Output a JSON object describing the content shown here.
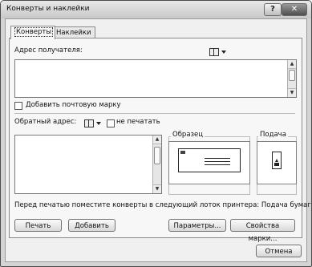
{
  "window": {
    "title": "Конверты и наклейки",
    "help_label": "?",
    "close_label": "✕"
  },
  "tabs": [
    {
      "label": "Конверты",
      "active": true
    },
    {
      "label": "Наклейки",
      "active": false
    }
  ],
  "recipient": {
    "label": "Адрес получателя:",
    "value": ""
  },
  "add_postage": {
    "label": "Добавить почтовую марку",
    "checked": false
  },
  "return_address": {
    "label": "Обратный адрес:",
    "value": "",
    "omit_label": "не печатать",
    "omit_checked": false
  },
  "preview": {
    "title": "Образец"
  },
  "feed": {
    "title": "Подача"
  },
  "notice": "Перед печатью поместите конверты в следующий лоток принтера: Подача бумаги.",
  "buttons": {
    "print": "Печать",
    "add": "Добавить",
    "options": "Параметры...",
    "postage_props": "Свойства марки...",
    "cancel": "Отмена"
  },
  "icons": {
    "address_book": "address-book-icon",
    "dropdown": "chevron-down-icon"
  }
}
